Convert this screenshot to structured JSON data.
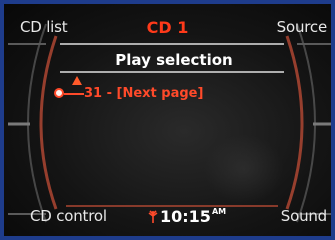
{
  "softkeys": {
    "top_left": "CD list",
    "top_right": "Source",
    "bottom_left": "CD control",
    "bottom_right": "Sound"
  },
  "source_title": "CD 1",
  "menu": {
    "title": "Play selection",
    "items": [
      {
        "label": "31 - [Next page]",
        "selected": true
      }
    ]
  },
  "status": {
    "time": "10:15",
    "ampm": "AM"
  },
  "colors": {
    "accent": "#ff4a2a",
    "frame_border": "#1e3c8c",
    "softkey_text": "#e8e8e8"
  },
  "icons": {
    "knob": "selection-knob-icon",
    "arrow": "scroll-up-arrow-icon",
    "antenna": "antenna-icon"
  }
}
